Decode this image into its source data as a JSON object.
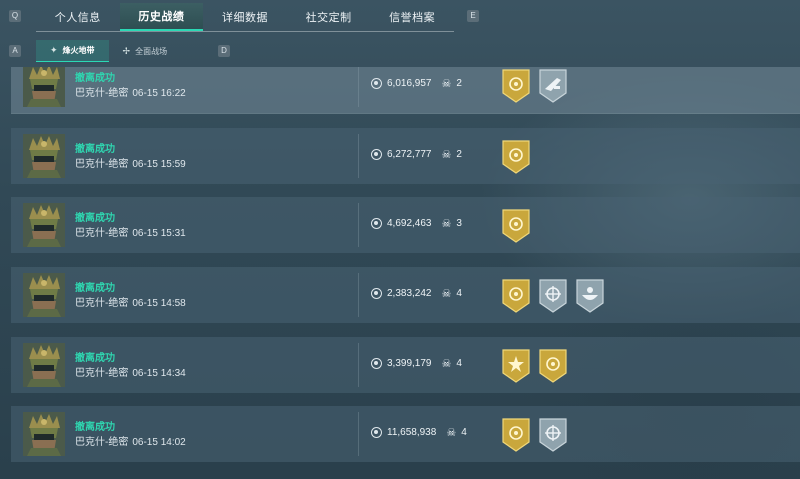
{
  "top_nav": {
    "left_key": "Q",
    "right_key": "E",
    "tabs": [
      "个人信息",
      "历史战绩",
      "详细数据",
      "社交定制",
      "信誉档案"
    ],
    "active_index": 1
  },
  "sub_nav": {
    "left_key": "A",
    "right_key": "D",
    "tabs": [
      "烽火地带",
      "全面战场"
    ],
    "active_index": 0
  },
  "icons": {
    "value": "coin-icon",
    "kills": "skull-icon"
  },
  "colors": {
    "accent": "#2bd9b5",
    "status_text": "#2fd6b0",
    "gold_badge": "#c9a73c",
    "silver_badge": "#8fa3ad"
  },
  "matches": [
    {
      "status": "撤离成功",
      "map": "巴克什-绝密",
      "time": "06-15 16:22",
      "value": "6,016,957",
      "kills": "2",
      "badges": [
        "gold-crest",
        "silver-weapon"
      ]
    },
    {
      "status": "撤离成功",
      "map": "巴克什-绝密",
      "time": "06-15 15:59",
      "value": "6,272,777",
      "kills": "2",
      "badges": [
        "gold-crest"
      ]
    },
    {
      "status": "撤离成功",
      "map": "巴克什-绝密",
      "time": "06-15 15:31",
      "value": "4,692,463",
      "kills": "3",
      "badges": [
        "gold-crest"
      ]
    },
    {
      "status": "撤离成功",
      "map": "巴克什-绝密",
      "time": "06-15 14:58",
      "value": "2,383,242",
      "kills": "4",
      "badges": [
        "gold-crest",
        "silver-crosshair",
        "silver-bowl"
      ]
    },
    {
      "status": "撤离成功",
      "map": "巴克什-绝密",
      "time": "06-15 14:34",
      "value": "3,399,179",
      "kills": "4",
      "badges": [
        "gold-star",
        "gold-crest"
      ]
    },
    {
      "status": "撤离成功",
      "map": "巴克什-绝密",
      "time": "06-15 14:02",
      "value": "11,658,938",
      "kills": "4",
      "badges": [
        "gold-crest",
        "silver-crosshair"
      ]
    }
  ]
}
